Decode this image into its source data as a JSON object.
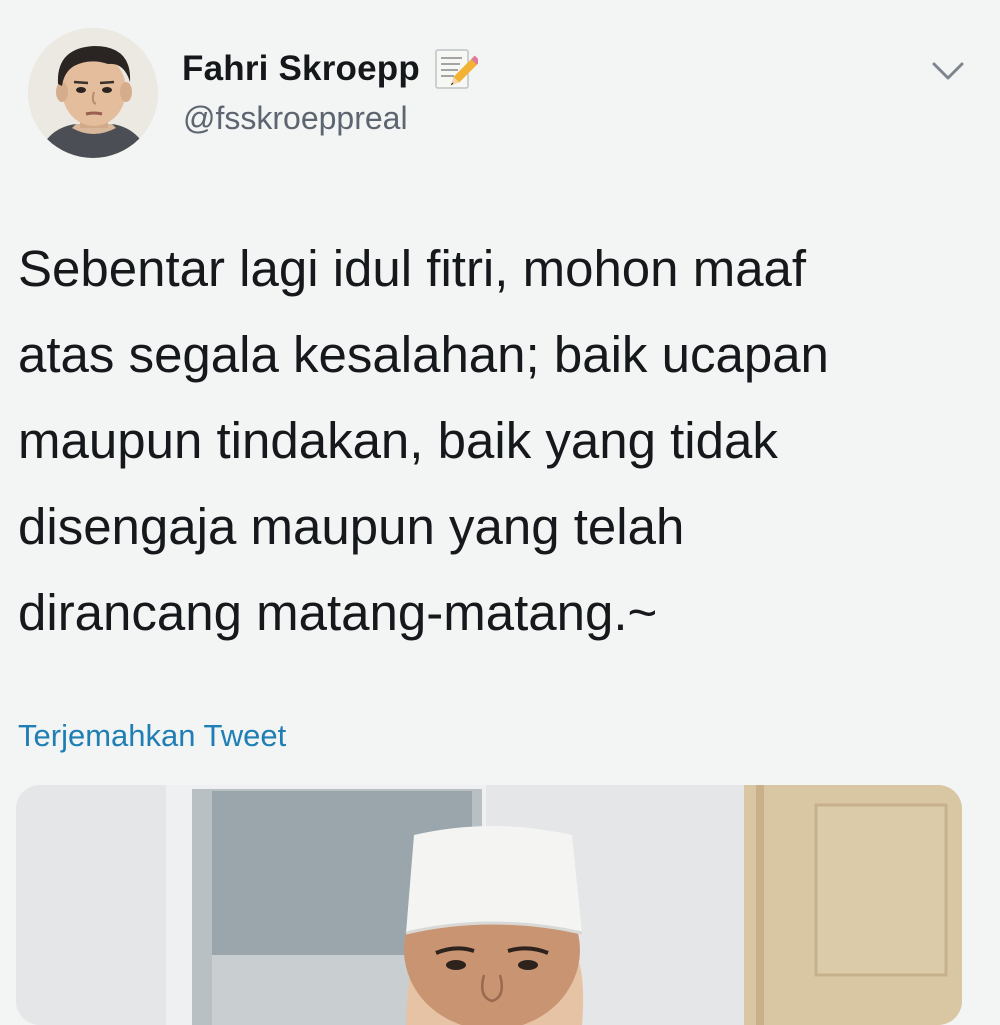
{
  "author": {
    "name": "Fahri Skroepp",
    "handle": "@fsskroeppreal",
    "badge_icon": "memo-pencil-icon"
  },
  "tweet": {
    "lines": [
      "Sebentar lagi idul fitri, mohon maaf",
      "atas segala kesalahan; baik ucapan",
      "maupun tindakan, baik yang tidak",
      "disengaja maupun yang telah",
      "dirancang matang-matang.~"
    ]
  },
  "actions": {
    "translate_label": "Terjemahkan Tweet",
    "menu_icon": "chevron-down-icon"
  },
  "colors": {
    "background": "#f3f4f4",
    "link": "#1f7fb5",
    "handle": "#5d6670"
  }
}
